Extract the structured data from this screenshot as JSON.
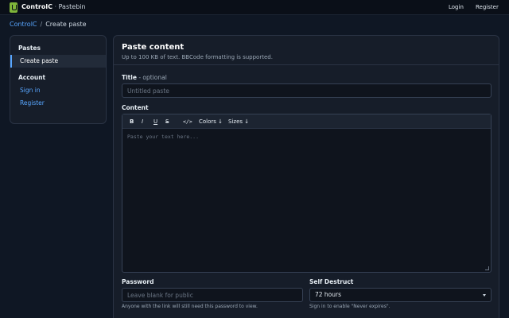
{
  "topbar": {
    "brand_name": "ControlC",
    "brand_separator": "·",
    "brand_sub": "Pastebin",
    "login": "Login",
    "register": "Register"
  },
  "breadcrumb": {
    "root": "ControlC",
    "separator": "/",
    "current": "Create paste"
  },
  "sidebar": {
    "pastes_heading": "Pastes",
    "create_paste": "Create paste",
    "account_heading": "Account",
    "sign_in": "Sign in",
    "register": "Register"
  },
  "panel": {
    "title": "Paste content",
    "description": "Up to 100 KB of text. BBCode formatting is supported."
  },
  "form": {
    "title_label": "Title",
    "title_optional": " - optional",
    "title_placeholder": "Untitled paste",
    "title_value": "",
    "content_label": "Content",
    "toolbar": {
      "bold": "B",
      "italic": "I",
      "underline": "U",
      "strike": "S",
      "code": "</>",
      "colors": "Colors ↓",
      "sizes": "Sizes ↓"
    },
    "content_placeholder": "Paste your text here...",
    "content_value": "",
    "password_label": "Password",
    "password_placeholder": "Leave blank for public",
    "password_value": "",
    "password_hint": "Anyone with the link will still need this password to view.",
    "self_destruct_label": "Self Destruct",
    "self_destruct_value": "72 hours",
    "self_destruct_hint": "Sign in to enable \"Never expires\"."
  },
  "colors": {
    "accent": "#58a6ff",
    "logo": "#7fb53a",
    "background": "#0f1724",
    "panel": "#161d29"
  },
  "icons": {
    "logo": "clipboard-icon",
    "dropdown": "chevron-down-icon",
    "resize": "resize-grip-icon"
  }
}
